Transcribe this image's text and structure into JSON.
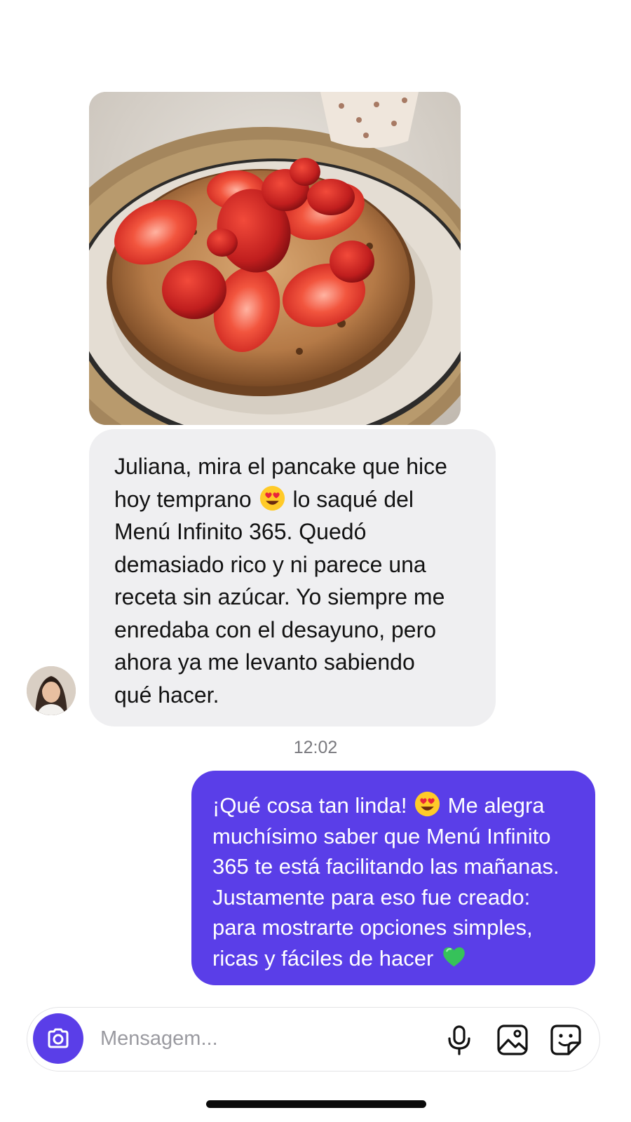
{
  "conversation": {
    "received": {
      "photo_alt": "",
      "text": "Juliana, mira el pancake que hice\nhoy temprano {emoji:heart-eyes} lo saqué del\nMenú Infinito 365. Quedó\ndemasiado rico y ni parece una\nreceta sin azúcar. Yo siempre me\nenredaba con el desayuno, pero\nahora ya me levanto sabiendo\nqué hacer.",
      "line1": "Juliana, mira el pancake que hice",
      "line2_before": "hoy temprano ",
      "line2_after": " lo saqué del",
      "line3": "Menú Infinito 365. Quedó",
      "line4": "demasiado rico y ni parece una",
      "line5": "receta sin azúcar. Yo siempre me",
      "line6": "enredaba con el desayuno, pero",
      "line7": "ahora ya me levanto sabiendo",
      "line8": "qué hacer."
    },
    "timestamp": "12:02",
    "sent": {
      "line1_before": "¡Qué cosa tan linda! ",
      "line1_after": " Me alegra",
      "line2": "muchísimo saber que Menú Infinito",
      "line3": "365 te está facilitando las mañanas.",
      "line4": "Justamente para eso fue creado:",
      "line5": "para mostrarte opciones simples,",
      "line6_before": "ricas y fáciles de hacer ",
      "line6_after": ""
    }
  },
  "composer": {
    "placeholder": "Mensagem...",
    "icons": [
      "camera-icon",
      "microphone-icon",
      "image-icon",
      "sticker-icon"
    ]
  },
  "colors": {
    "accent": "#5a3ee8",
    "received_bubble": "#efeff1",
    "sent_text": "#ffffff",
    "timestamp": "#7a7a7f"
  }
}
